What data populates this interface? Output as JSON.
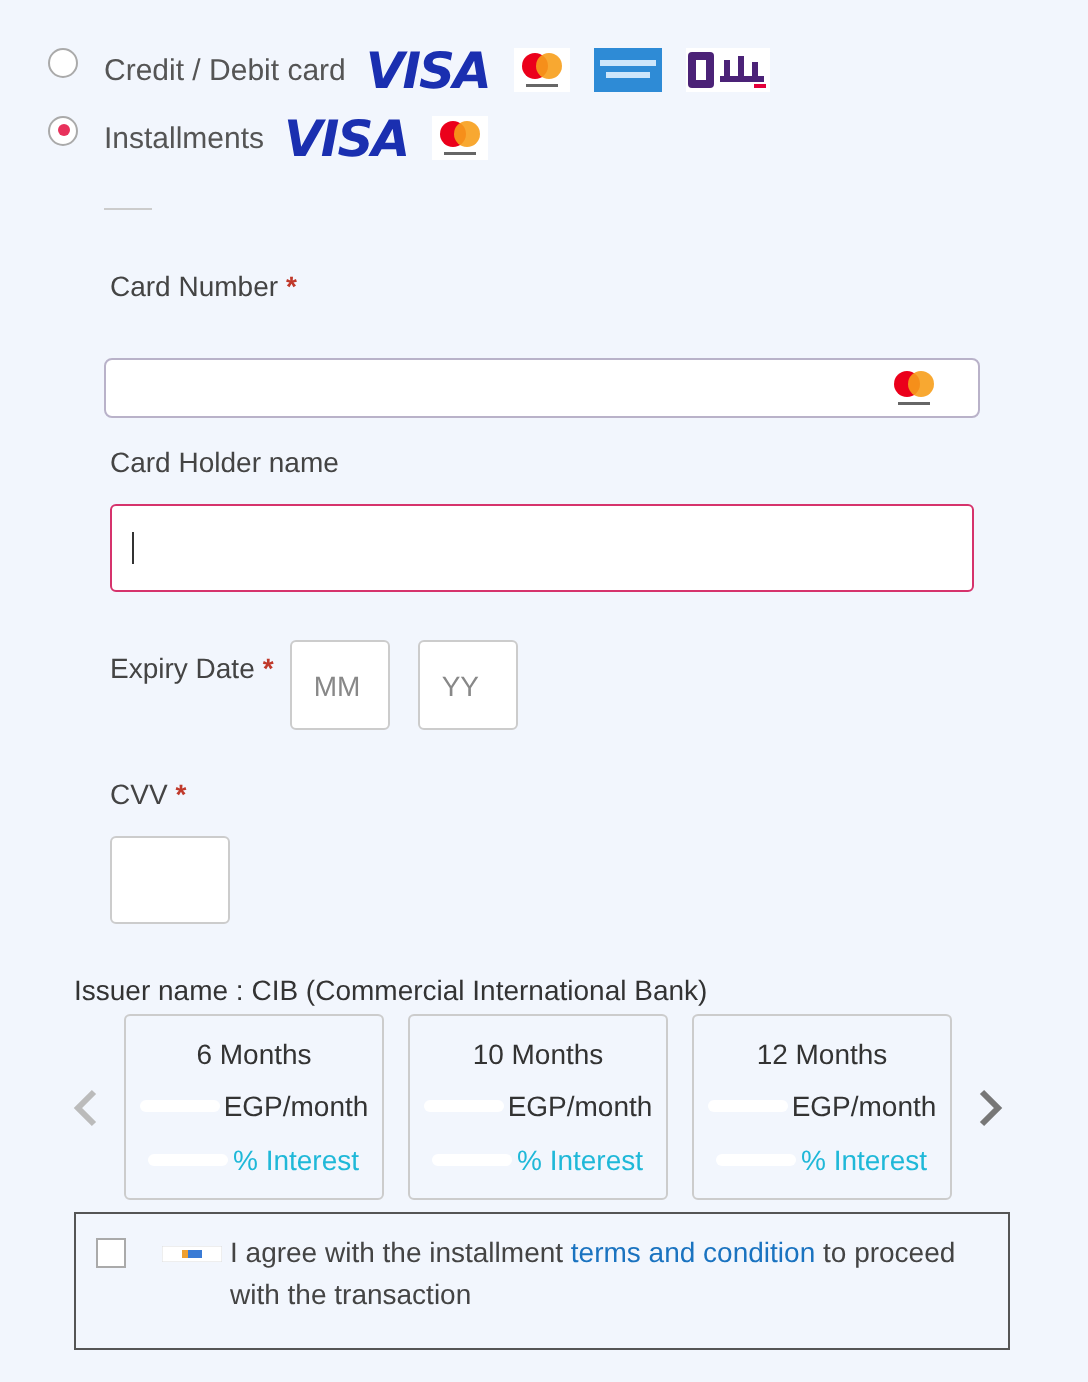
{
  "payment_methods": [
    {
      "label": "Credit / Debit card",
      "selected": false,
      "logos": [
        {
          "kind": "visa",
          "text": "VISA"
        },
        {
          "kind": "mastercard"
        },
        {
          "kind": "amex"
        },
        {
          "kind": "meeza"
        }
      ]
    },
    {
      "label": "Installments",
      "selected": true,
      "logos": [
        {
          "kind": "visa",
          "text": "VISA"
        },
        {
          "kind": "mastercard"
        }
      ]
    }
  ],
  "fields": [
    {
      "kind": "card",
      "label": "Card Number",
      "mark": "*"
    },
    {
      "kind": "text",
      "label": "Card Holder name",
      "focused": true
    },
    {
      "kind": "expiry",
      "label": "Expiry Date",
      "mark": "*",
      "placeholders": [
        "MM",
        "YY"
      ]
    },
    {
      "kind": "cvv",
      "label": "CVV",
      "mark": "*"
    }
  ],
  "issuer": "Issuer name : CIB (Commercial International Bank)",
  "plans": [
    {
      "duration": "6 Months",
      "amount": "EGP/month",
      "interest": "% Interest"
    },
    {
      "duration": "10 Months",
      "amount": "EGP/month",
      "interest": "% Interest"
    },
    {
      "duration": "12 Months",
      "amount": "EGP/month",
      "interest": "% Interest"
    }
  ],
  "agreement": {
    "checked": false,
    "before": "I agree with the installment",
    "link": "terms and condition",
    "after": "to proceed with the transaction"
  }
}
